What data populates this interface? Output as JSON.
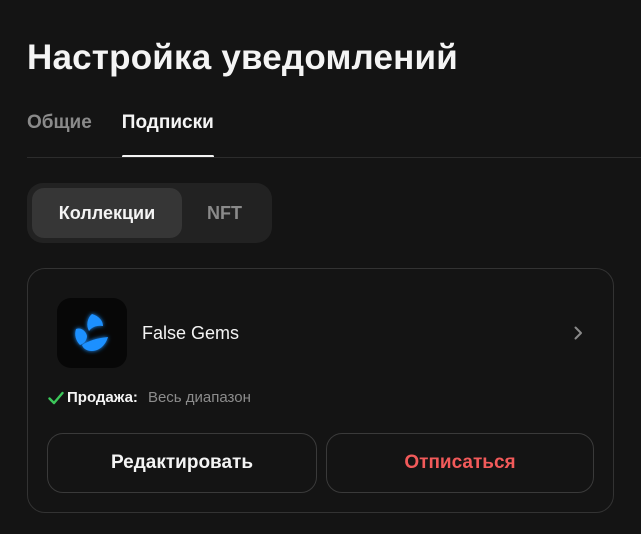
{
  "page": {
    "title": "Настройка уведомлений"
  },
  "tabs": [
    {
      "label": "Общие",
      "active": false
    },
    {
      "label": "Подписки",
      "active": true
    }
  ],
  "segment": {
    "options": [
      {
        "label": "Коллекции",
        "active": true
      },
      {
        "label": "NFT",
        "active": false
      }
    ]
  },
  "subscription": {
    "collection_name": "False Gems",
    "logo_icon": "false-gems-logo",
    "filter_label": "Продажа:",
    "filter_value": "Весь диапазон",
    "edit_label": "Редактировать",
    "unsubscribe_label": "Отписаться"
  },
  "colors": {
    "background": "#141414",
    "accent_check": "#3cc75a",
    "danger": "#f25a5a",
    "logo_blue": "#1e90ff"
  }
}
